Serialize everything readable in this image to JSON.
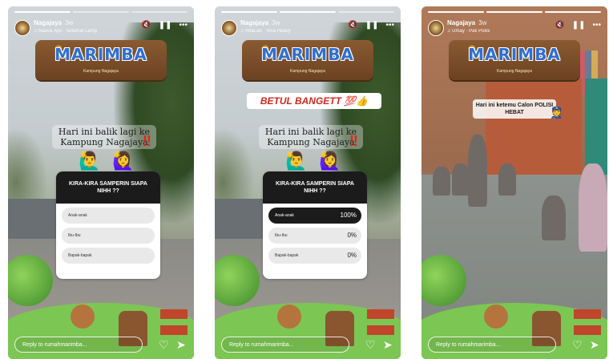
{
  "stories": [
    {
      "username": "Nagajaya",
      "time": "3w",
      "music": "Nauva Ayu · Selamat Lamp",
      "logo_title": "MARIMBA",
      "logo_subtitle": "Kampung Nagajaya",
      "caption": "Hari ini balik lagi ke Kampung Nagajaya",
      "quiz": {
        "question": "KIRA-KIRA SAMPERIN SIAPA NIHH ??",
        "options": [
          {
            "label": "Anak-anak"
          },
          {
            "label": "Ibu-Ibu"
          },
          {
            "label": "Bapak-bapak"
          }
        ]
      },
      "reply_placeholder": "Reply to rumahmarimba..."
    },
    {
      "username": "Nagajaya",
      "time": "3w",
      "music": "HitaLab · Vina Heavy",
      "logo_title": "MARIMBA",
      "logo_subtitle": "Kampung Nagajaya",
      "sticker": "BETUL BANGETT 💯👍",
      "caption": "Hari ini balik lagi ke Kampung Nagajaya",
      "quiz": {
        "question": "KIRA-KIRA SAMPERIN SIAPA NIHH ??",
        "options": [
          {
            "label": "Anak-anak",
            "pct": "100%"
          },
          {
            "label": "Ibu-Ibu",
            "pct": "0%"
          },
          {
            "label": "Bapak-bapak",
            "pct": "0%"
          }
        ]
      },
      "reply_placeholder": "Reply to rumahmarimba..."
    },
    {
      "username": "Nagajaya",
      "time": "3w",
      "music": "Umay · Pak Polisi",
      "logo_title": "MARIMBA",
      "logo_subtitle": "Kampung Nagajaya",
      "sticker": "Hari ini ketemu Calon POLISI HEBAT",
      "reply_placeholder": "Reply to rumahmarimba..."
    }
  ],
  "colors": {
    "brand_blue": "#2f6fd0",
    "exclaim_red": "#e0261b",
    "wood": "#6b4222"
  },
  "icons": [
    "mute-icon",
    "pause-icon",
    "more-icon",
    "heart-icon",
    "send-icon"
  ]
}
